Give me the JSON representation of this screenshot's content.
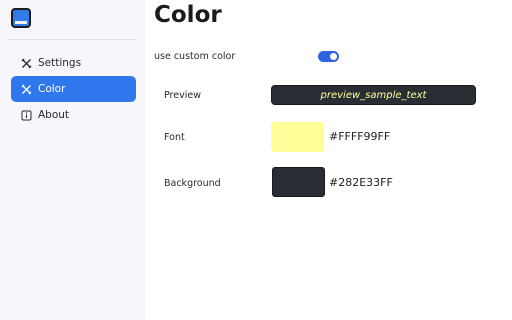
{
  "sidebar": {
    "items": [
      {
        "label": "Settings",
        "icon": "settings-icon"
      },
      {
        "label": "Color",
        "icon": "color-icon",
        "active": true
      },
      {
        "label": "About",
        "icon": "info-icon"
      }
    ]
  },
  "main": {
    "title": "Color",
    "custom_color": {
      "label": "use custom color",
      "enabled": true
    },
    "preview": {
      "label": "Preview",
      "text": "preview_sample_text"
    },
    "font": {
      "label": "Font",
      "value": "#FFFF99FF",
      "swatch_color": "#FFFF99"
    },
    "background": {
      "label": "Background",
      "value": "#282E33FF",
      "swatch_color": "#282E33"
    }
  },
  "colors": {
    "accent": "#2F77EC",
    "toggle": "#2F62E0"
  }
}
